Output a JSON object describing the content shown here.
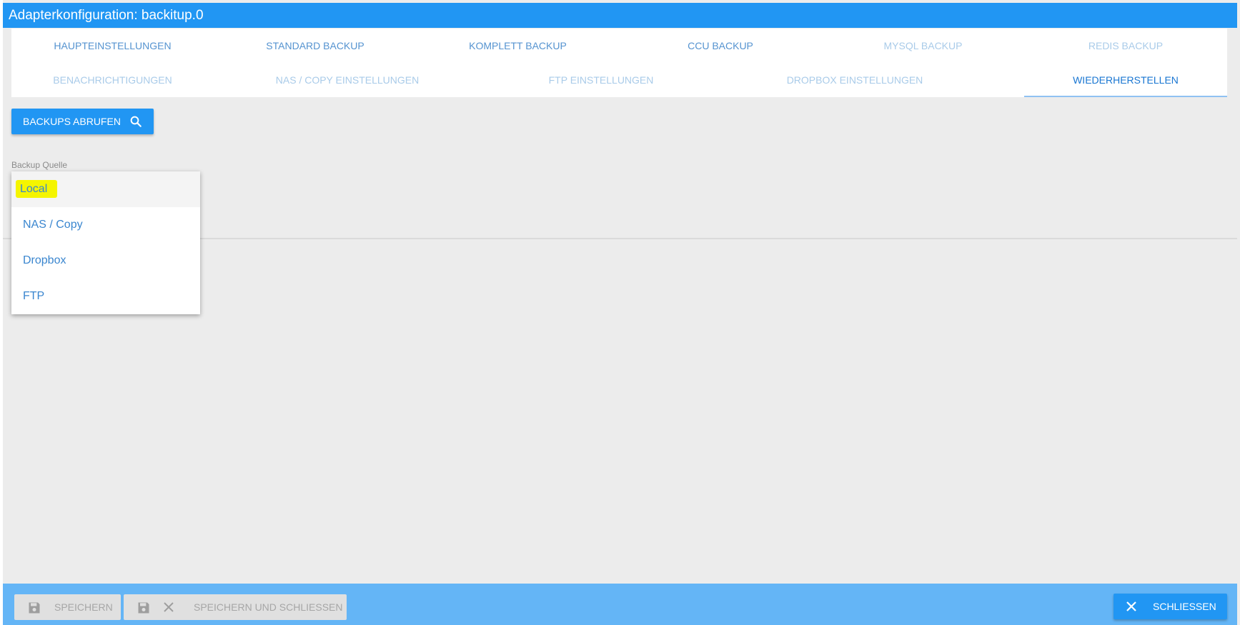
{
  "window": {
    "title": "Adapterkonfiguration: backitup.0"
  },
  "tabs": {
    "row1": [
      {
        "label": "HAUPTEINSTELLUNGEN",
        "state": "normal"
      },
      {
        "label": "STANDARD BACKUP",
        "state": "normal"
      },
      {
        "label": "KOMPLETT BACKUP",
        "state": "normal"
      },
      {
        "label": "CCU BACKUP",
        "state": "normal"
      },
      {
        "label": "MYSQL BACKUP",
        "state": "disabled"
      },
      {
        "label": "REDIS BACKUP",
        "state": "disabled"
      }
    ],
    "row2": [
      {
        "label": "BENACHRICHTIGUNGEN",
        "state": "disabled"
      },
      {
        "label": "NAS / COPY EINSTELLUNGEN",
        "state": "disabled"
      },
      {
        "label": "FTP EINSTELLUNGEN",
        "state": "disabled"
      },
      {
        "label": "DROPBOX EINSTELLUNGEN",
        "state": "disabled"
      },
      {
        "label": "WIEDERHERSTELLEN",
        "state": "active"
      }
    ]
  },
  "restore": {
    "fetch_button": {
      "label": "BACKUPS ABRUFEN",
      "icon": "search-icon"
    },
    "source_label": "Backup Quelle",
    "source_options": [
      "Local",
      "NAS / Copy",
      "Dropbox",
      "FTP"
    ],
    "selected_option": "Local"
  },
  "footer": {
    "save_label": "SPEICHERN",
    "save_close_label": "SPEICHERN UND SCHLIESSEN",
    "close_label": "SCHLIESSEN"
  },
  "colors": {
    "primary": "#2196f3",
    "footer": "#64b5f6",
    "tab_text": "#5593d0",
    "tab_disabled": "#a9cbe9",
    "highlight": "#f5f500"
  }
}
